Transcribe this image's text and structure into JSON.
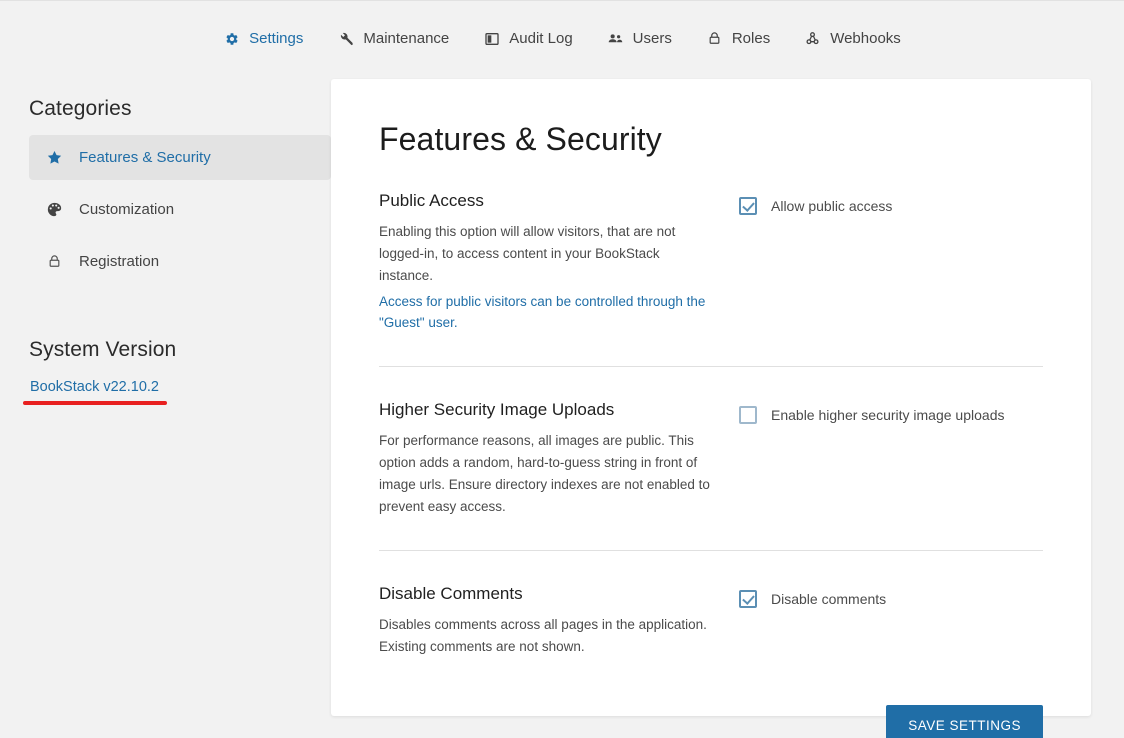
{
  "topnav": {
    "items": [
      {
        "label": "Settings",
        "icon": "gear-icon",
        "active": true
      },
      {
        "label": "Maintenance",
        "icon": "wrench-icon",
        "active": false
      },
      {
        "label": "Audit Log",
        "icon": "book-icon",
        "active": false
      },
      {
        "label": "Users",
        "icon": "users-icon",
        "active": false
      },
      {
        "label": "Roles",
        "icon": "lock-icon",
        "active": false
      },
      {
        "label": "Webhooks",
        "icon": "webhook-icon",
        "active": false
      }
    ]
  },
  "sidebar": {
    "categories_heading": "Categories",
    "items": [
      {
        "label": "Features & Security",
        "icon": "star-icon",
        "active": true
      },
      {
        "label": "Customization",
        "icon": "palette-icon",
        "active": false
      },
      {
        "label": "Registration",
        "icon": "lock-icon",
        "active": false
      }
    ],
    "version_heading": "System Version",
    "version_link": "BookStack v22.10.2"
  },
  "main": {
    "page_title": "Features & Security",
    "sections": [
      {
        "title": "Public Access",
        "description": "Enabling this option will allow visitors, that are not logged-in, to access content in your BookStack instance.",
        "note": "Access for public visitors can be controlled through the \"Guest\" user.",
        "checkbox_label": "Allow public access",
        "checked": true
      },
      {
        "title": "Higher Security Image Uploads",
        "description": "For performance reasons, all images are public. This option adds a random, hard-to-guess string in front of image urls. Ensure directory indexes are not enabled to prevent easy access.",
        "note": "",
        "checkbox_label": "Enable higher security image uploads",
        "checked": false
      },
      {
        "title": "Disable Comments",
        "description": "Disables comments across all pages in the application. Existing comments are not shown.",
        "note": "",
        "checkbox_label": "Disable comments",
        "checked": true
      }
    ],
    "save_label": "SAVE SETTINGS"
  },
  "annotation": {
    "highlight_color": "#e82020",
    "target": "BookStack v22.10.2"
  },
  "colors": {
    "accent": "#206ea7",
    "page_bg": "#f2f2f2",
    "card_bg": "#ffffff",
    "active_item_bg": "#e3e3e3"
  }
}
